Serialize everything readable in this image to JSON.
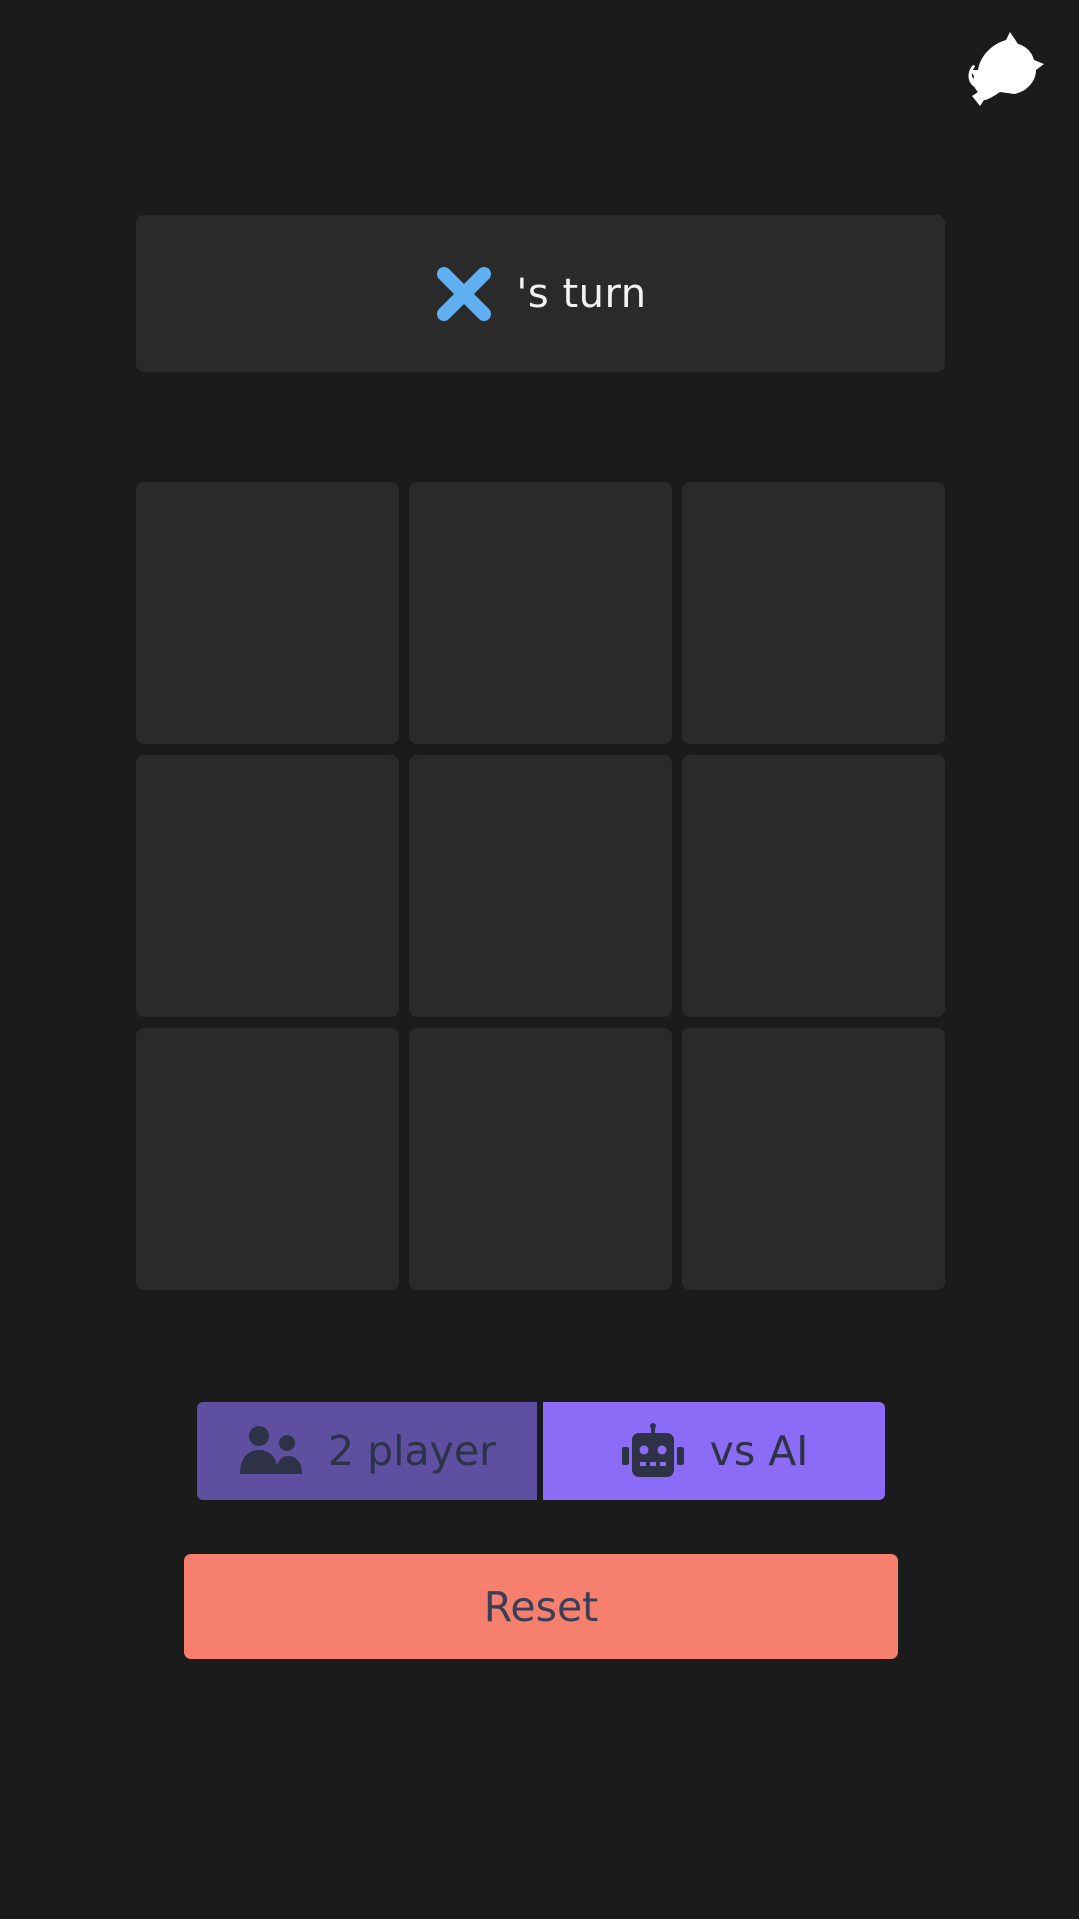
{
  "header": {
    "github_icon": "github-octocat-icon"
  },
  "status": {
    "current_player_icon": "x-mark-icon",
    "turn_text": "'s turn",
    "x_color": "#5fb0f2"
  },
  "board": {
    "cells": [
      "",
      "",
      "",
      "",
      "",
      "",
      "",
      "",
      ""
    ]
  },
  "modes": {
    "two_player": {
      "icon": "users-icon",
      "label": "2 player",
      "color": "#5e4fa0"
    },
    "vs_ai": {
      "icon": "robot-icon",
      "label": "vs AI",
      "color": "#8c6cf6"
    }
  },
  "reset": {
    "label": "Reset",
    "color": "#f67f6e"
  }
}
